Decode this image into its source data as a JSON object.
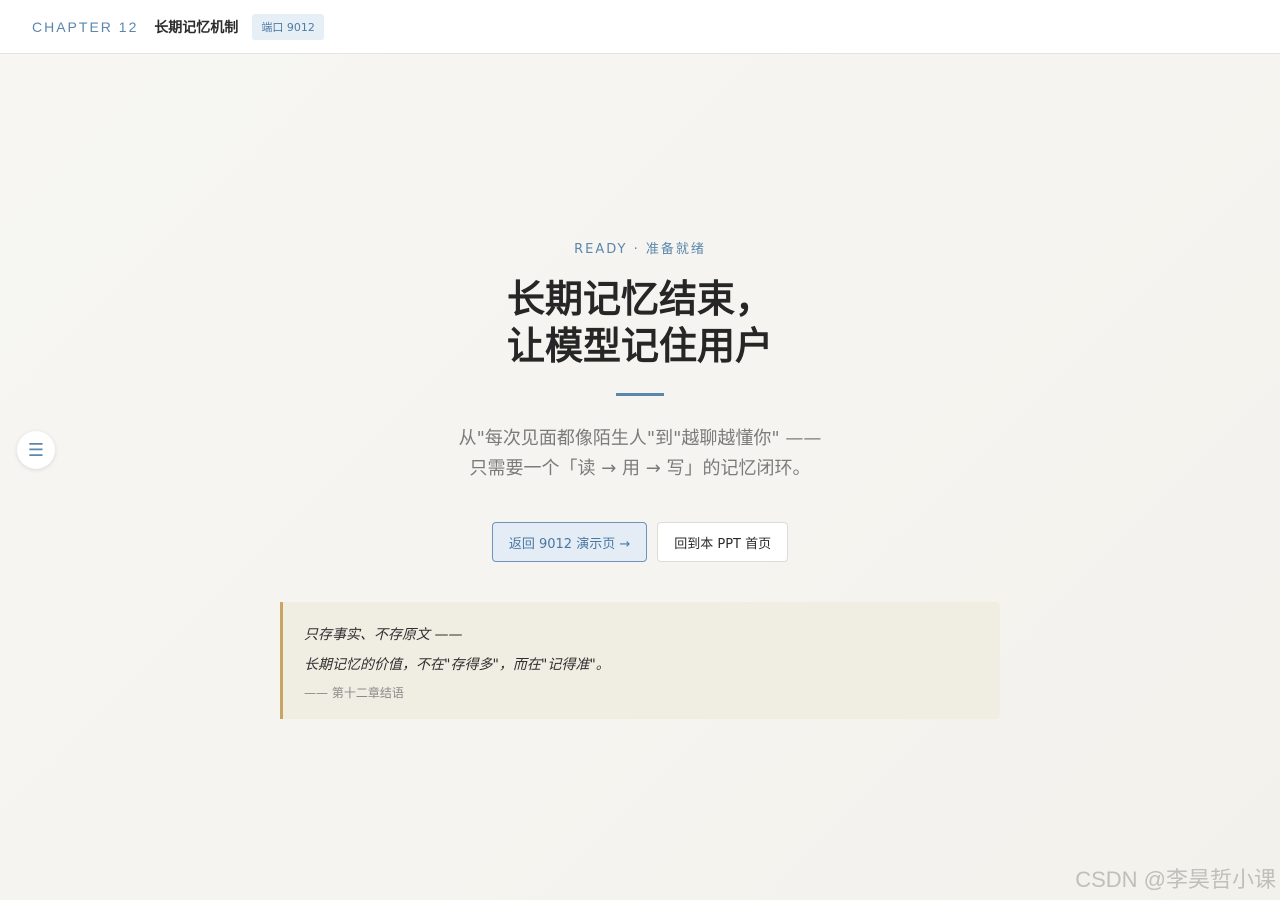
{
  "header": {
    "chapter": "CHAPTER 12",
    "title": "长期记忆机制",
    "port_badge": "端口 9012"
  },
  "sidebar_toggle": {
    "icon": "☰",
    "icon_name": "menu-icon"
  },
  "hero": {
    "eyebrow": "READY · 准备就绪",
    "headline_line1": "长期记忆结束，",
    "headline_line2": "让模型记住用户",
    "subtitle_line1": "从\"每次见面都像陌生人\"到\"越聊越懂你\" ——",
    "subtitle_line2": "只需要一个「读 → 用 → 写」的记忆闭环。"
  },
  "buttons": {
    "primary_label": "返回 9012 演示页 →",
    "secondary_label": "回到本 PPT 首页"
  },
  "quote": {
    "line1": "只存事实、不存原文 ——",
    "line2": "长期记忆的价值，不在\"存得多\"，而在\"记得准\"。",
    "source": "—— 第十二章结语"
  },
  "watermark": "CSDN @李昊哲小课",
  "colors": {
    "accent": "#5b87ad",
    "quote_border": "#c9a563",
    "quote_bg": "#f0ede3"
  }
}
